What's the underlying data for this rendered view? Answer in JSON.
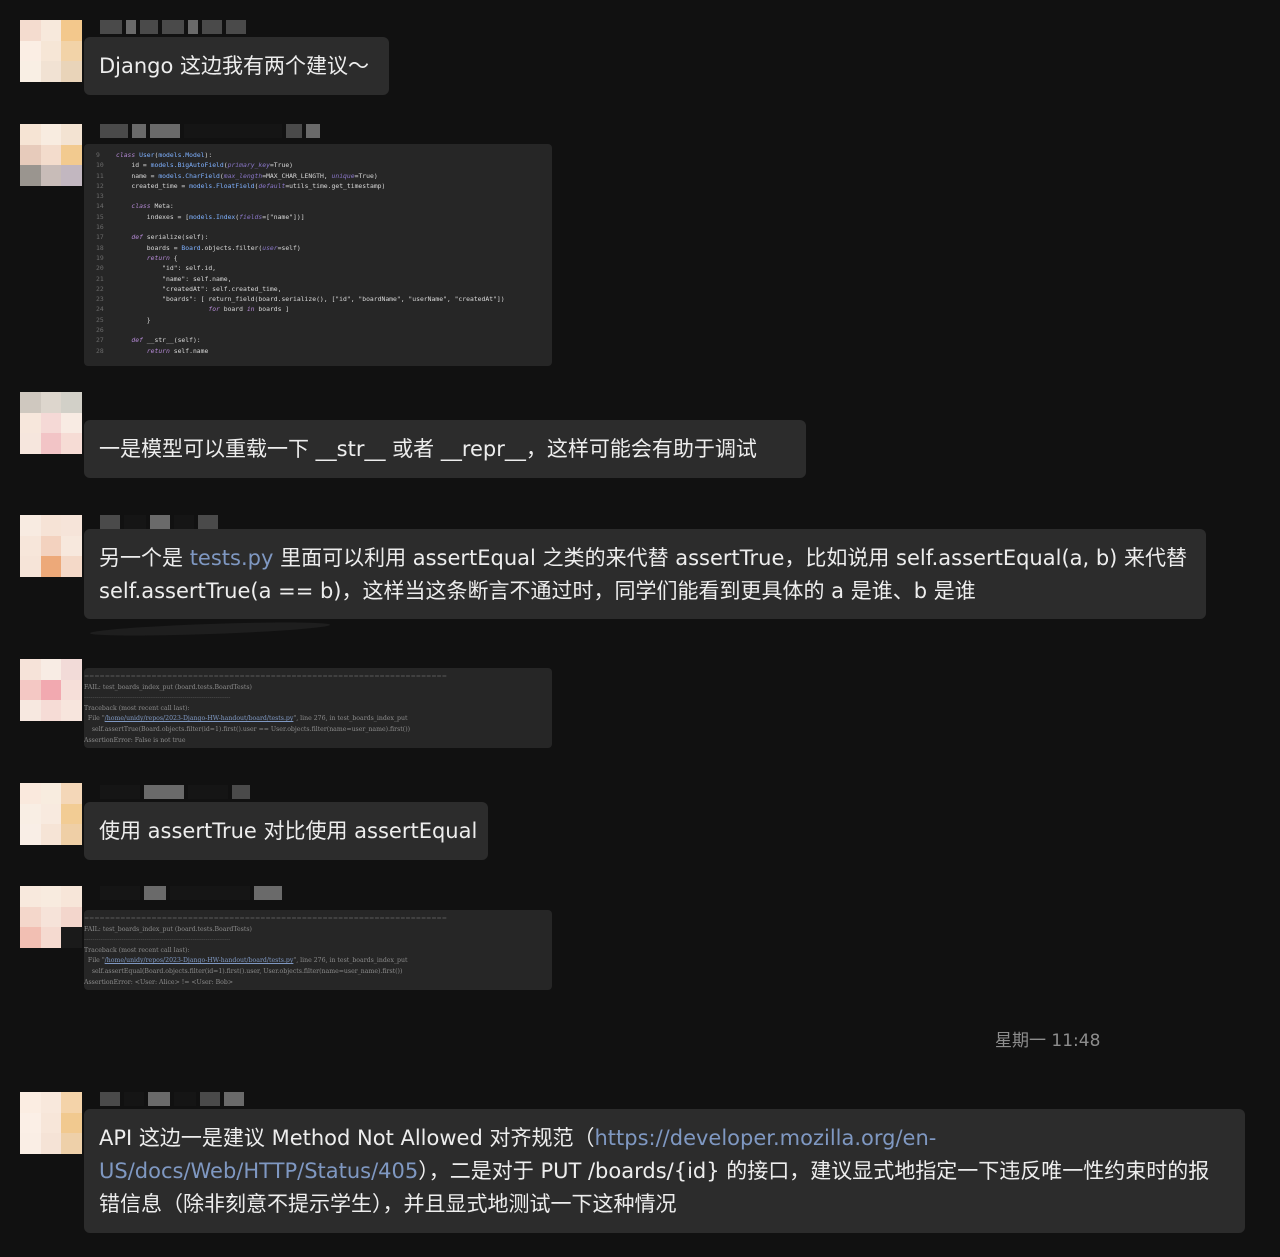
{
  "messages": [
    {
      "kind": "text",
      "text": "Django 这边我有两个建议～"
    },
    {
      "kind": "code-screenshot",
      "lines": [
        {
          "n": "9",
          "t": "class User(models.Model):"
        },
        {
          "n": "10",
          "t": "    id = models.BigAutoField(primary_key=True)"
        },
        {
          "n": "11",
          "t": "    name = models.CharField(max_length=MAX_CHAR_LENGTH, unique=True)"
        },
        {
          "n": "12",
          "t": "    created_time = models.FloatField(default=utils_time.get_timestamp)"
        },
        {
          "n": "13",
          "t": ""
        },
        {
          "n": "14",
          "t": "    class Meta:"
        },
        {
          "n": "15",
          "t": "        indexes = [models.Index(fields=[\"name\"])]"
        },
        {
          "n": "16",
          "t": ""
        },
        {
          "n": "17",
          "t": "    def serialize(self):"
        },
        {
          "n": "18",
          "t": "        boards = Board.objects.filter(user=self)"
        },
        {
          "n": "19",
          "t": "        return {"
        },
        {
          "n": "20",
          "t": "            \"id\": self.id,"
        },
        {
          "n": "21",
          "t": "            \"name\": self.name,"
        },
        {
          "n": "22",
          "t": "            \"createdAt\": self.created_time,"
        },
        {
          "n": "23",
          "t": "            \"boards\": [ return_field(board.serialize(), [\"id\", \"boardName\", \"userName\", \"createdAt\"])"
        },
        {
          "n": "24",
          "t": "                        for board in boards ]"
        },
        {
          "n": "25",
          "t": "        }"
        },
        {
          "n": "26",
          "t": ""
        },
        {
          "n": "27",
          "t": "    def __str__(self):"
        },
        {
          "n": "28",
          "t": "        return self.name"
        }
      ]
    },
    {
      "kind": "text",
      "text": "一是模型可以重载一下 __str__ 或者 __repr__，这样可能会有助于调试"
    },
    {
      "kind": "text-with-link",
      "before": "另一个是 ",
      "link": "tests.py",
      "after": " 里面可以利用 assertEqual 之类的来代替 assertTrue，比如说用 self.assertEqual(a, b) 来代替 self.assertTrue(a == b)，这样当这条断言不通过时，同学们能看到更具体的 a 是谁、b 是谁"
    },
    {
      "kind": "traceback-screenshot",
      "lines": [
        "======================================================================",
        "FAIL: test_boards_index_put (board.tests.BoardTests)",
        "----------------------------------------------------------------------",
        "Traceback (most recent call last):",
        "  File \"/home/unidy/repos/2023-Django-HW-handout/board/tests.py\", line 276, in test_boards_index_put",
        "    self.assertTrue(Board.objects.filter(id=1).first().user == User.objects.filter(name=user_name).first())",
        "AssertionError: False is not true"
      ]
    },
    {
      "kind": "text",
      "text": "使用 assertTrue 对比使用 assertEqual"
    },
    {
      "kind": "traceback-screenshot",
      "lines": [
        "======================================================================",
        "FAIL: test_boards_index_put (board.tests.BoardTests)",
        "----------------------------------------------------------------------",
        "Traceback (most recent call last):",
        "  File \"/home/unidy/repos/2023-Django-HW-handout/board/tests.py\", line 276, in test_boards_index_put",
        "    self.assertEqual(Board.objects.filter(id=1).first().user, User.objects.filter(name=user_name).first())",
        "AssertionError: <User: Alice> != <User: Bob>"
      ]
    }
  ],
  "timestamp": "星期一 11:48",
  "last_message": {
    "before": "API 这边一是建议 Method Not Allowed 对齐规范（",
    "link": "https://developer.mozilla.org/en-US/docs/Web/HTTP/Status/405",
    "after": "），二是对于 PUT /boards/{id} 的接口，建议显式地指定一下违反唯一性约束时的报错信息（除非刻意不提示学生），并且显式地测试一下这种情况"
  }
}
